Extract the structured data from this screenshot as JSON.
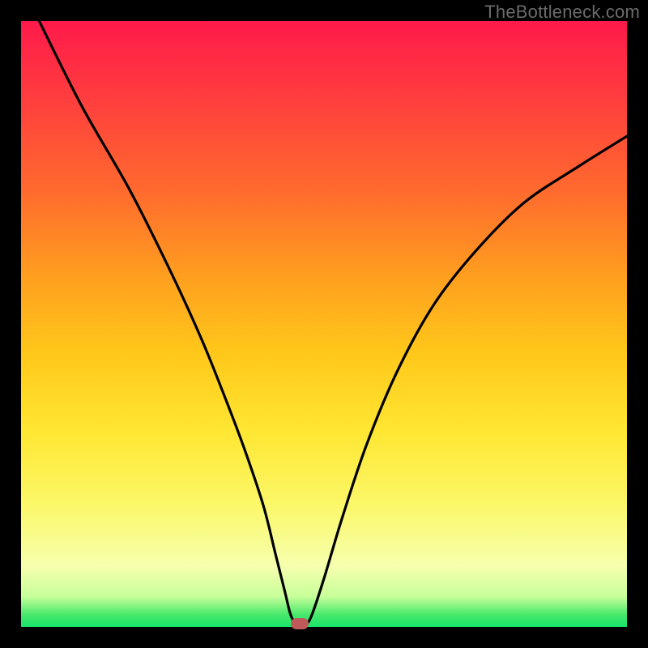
{
  "watermark": "TheBottleneck.com",
  "colors": {
    "frame": "#000000",
    "curve": "#000000",
    "marker": "#c05a5a"
  },
  "chart_data": {
    "type": "line",
    "title": "",
    "xlabel": "",
    "ylabel": "",
    "xlim": [
      0,
      100
    ],
    "ylim": [
      0,
      100
    ],
    "grid": false,
    "legend": false,
    "series": [
      {
        "name": "bottleneck-curve",
        "x": [
          3,
          10,
          18,
          25,
          30,
          34,
          37,
          40,
          42,
          43.5,
          44.5,
          45.5,
          47,
          48,
          50,
          53,
          57,
          62,
          68,
          75,
          83,
          92,
          100
        ],
        "y": [
          100,
          86,
          72,
          58,
          47,
          37,
          29,
          20,
          12,
          6,
          2,
          0.5,
          0.5,
          2,
          8,
          18,
          30,
          42,
          53,
          62,
          70,
          76,
          81
        ]
      }
    ],
    "curve_minimum_x": 46,
    "background_gradient": {
      "top": "#ff1a4b",
      "mid": "#ffe733",
      "bottom": "#17e36a"
    },
    "marker": {
      "x": 46,
      "y": 0.5
    }
  }
}
